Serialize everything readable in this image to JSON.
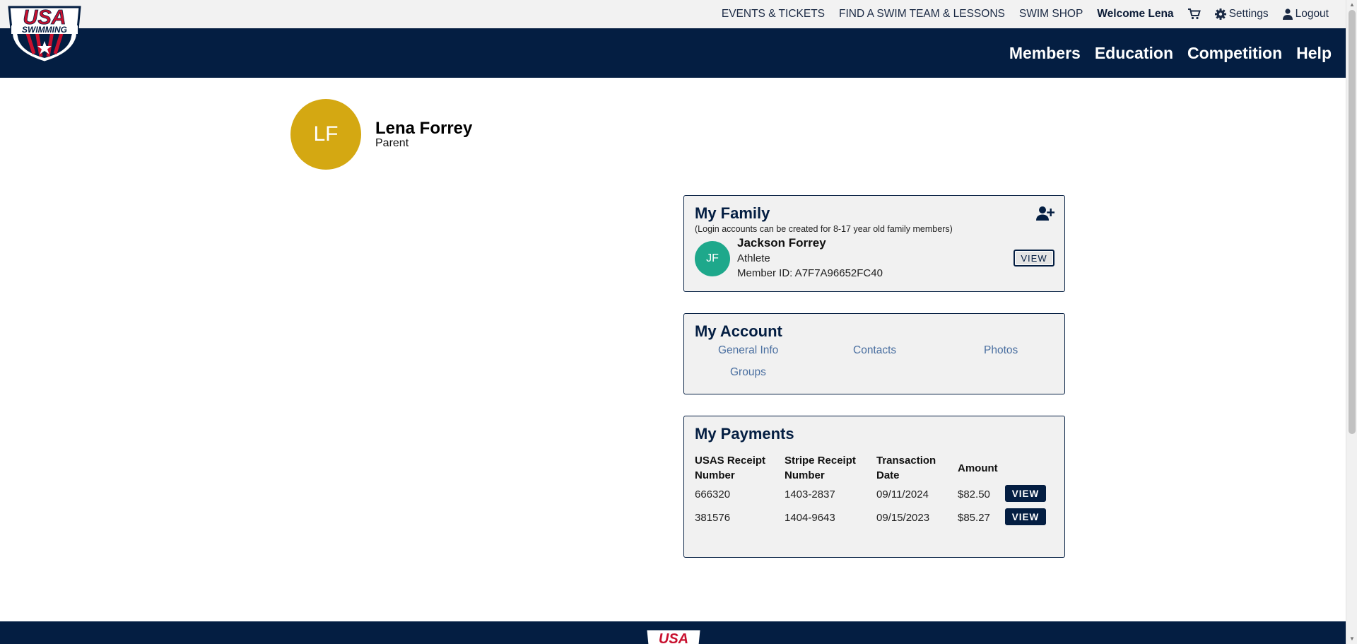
{
  "header": {
    "links": {
      "events": "EVENTS & TICKETS",
      "find_team": "FIND A SWIM TEAM & LESSONS",
      "shop": "SWIM SHOP",
      "welcome": "Welcome Lena",
      "settings": "Settings",
      "logout": "Logout"
    },
    "icons": {
      "cart": "cart-icon",
      "settings": "gear-icon",
      "logout": "user-icon"
    },
    "logo": {
      "top_text": "USA",
      "bottom_text": "SWIMMING"
    }
  },
  "nav": {
    "members": "Members",
    "education": "Education",
    "competition": "Competition",
    "help": "Help"
  },
  "profile": {
    "initials": "LF",
    "name": "Lena Forrey",
    "role": "Parent"
  },
  "family": {
    "title": "My Family",
    "note": "(Login accounts can be created for 8-17 year old family members)",
    "add_icon": "add-user-icon",
    "members": [
      {
        "initials": "JF",
        "name": "Jackson Forrey",
        "role": "Athlete",
        "member_id": "Member ID: A7F7A96652FC40",
        "button": "VIEW"
      }
    ]
  },
  "account": {
    "title": "My Account",
    "links": {
      "general_info": "General Info",
      "contacts": "Contacts",
      "photos": "Photos",
      "groups": "Groups"
    }
  },
  "payments": {
    "title": "My Payments",
    "columns": {
      "usas_1": "USAS Receipt",
      "usas_2": "Number",
      "stripe_1": "Stripe Receipt",
      "stripe_2": "Number",
      "date_1": "Transaction",
      "date_2": "Date",
      "amount": "Amount"
    },
    "rows": [
      {
        "usas": "666320",
        "stripe": "1403-2837",
        "date": "09/11/2024",
        "amount": "$82.50",
        "button": "VIEW"
      },
      {
        "usas": "381576",
        "stripe": "1404-9643",
        "date": "09/15/2023",
        "amount": "$85.27",
        "button": "VIEW"
      }
    ]
  },
  "colors": {
    "navy": "#041e42",
    "avatar_parent": "#d4a812",
    "avatar_child": "#1ea88b",
    "link": "#4a6fa0",
    "brand_red": "#c8102e"
  }
}
